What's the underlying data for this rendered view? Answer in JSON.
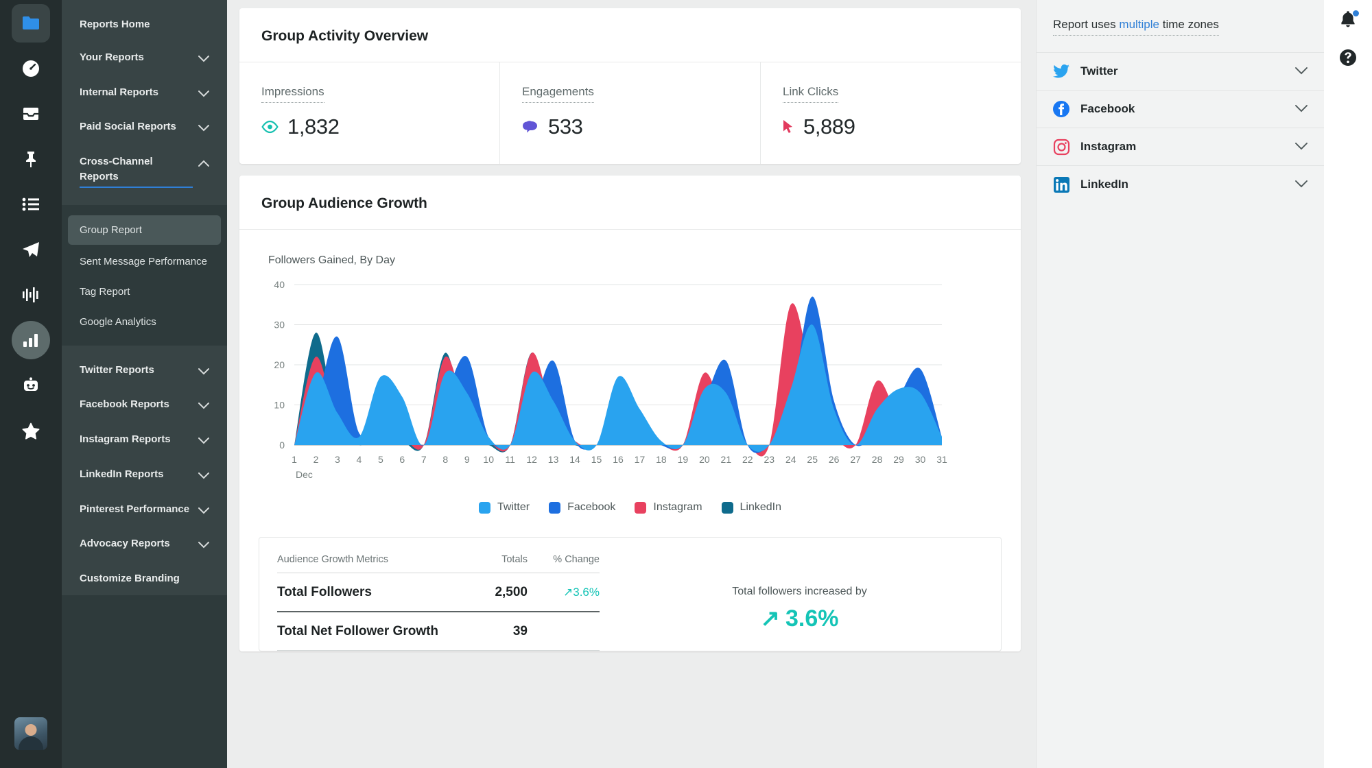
{
  "rail": {
    "items": [
      {
        "name": "folder-icon",
        "label": "Folder"
      },
      {
        "name": "dashboard-icon",
        "label": "Dashboard"
      },
      {
        "name": "inbox-icon",
        "label": "Inbox"
      },
      {
        "name": "pin-icon",
        "label": "Publishing"
      },
      {
        "name": "list-icon",
        "label": "Tasks"
      },
      {
        "name": "send-icon",
        "label": "Compose"
      },
      {
        "name": "pulse-icon",
        "label": "Listening"
      },
      {
        "name": "bar-chart-icon",
        "label": "Analytics"
      },
      {
        "name": "bot-icon",
        "label": "Bots"
      },
      {
        "name": "star-icon",
        "label": "Favorites"
      }
    ]
  },
  "nav": {
    "primary": [
      {
        "label": "Reports Home",
        "chevron": false,
        "underlined": false
      },
      {
        "label": "Your Reports",
        "chevron": true,
        "underlined": false
      },
      {
        "label": "Internal Reports",
        "chevron": true,
        "underlined": false
      },
      {
        "label": "Paid Social Reports",
        "chevron": true,
        "underlined": false
      },
      {
        "label": "Cross-Channel Reports",
        "chevron": true,
        "underlined": true
      }
    ],
    "sub": [
      {
        "label": "Group Report",
        "selected": true
      },
      {
        "label": "Sent Message Performance",
        "selected": false
      },
      {
        "label": "Tag Report",
        "selected": false
      },
      {
        "label": "Google Analytics",
        "selected": false
      }
    ],
    "secondary": [
      {
        "label": "Twitter Reports",
        "chevron": true
      },
      {
        "label": "Facebook Reports",
        "chevron": true
      },
      {
        "label": "Instagram Reports",
        "chevron": true
      },
      {
        "label": "LinkedIn Reports",
        "chevron": true
      },
      {
        "label": "Pinterest Performance",
        "chevron": true
      },
      {
        "label": "Advocacy Reports",
        "chevron": true
      },
      {
        "label": "Customize Branding",
        "chevron": false
      }
    ]
  },
  "activity": {
    "title": "Group Activity Overview",
    "metrics": [
      {
        "label": "Impressions",
        "value": "1,832",
        "icon": "eye-icon",
        "color": "#16c0b0"
      },
      {
        "label": "Engagements",
        "value": "533",
        "icon": "speech-bubbles-icon",
        "color": "#6155d6"
      },
      {
        "label": "Link Clicks",
        "value": "5,889",
        "icon": "cursor-arrow-icon",
        "color": "#e23a5e"
      }
    ]
  },
  "growth": {
    "title": "Group Audience Growth",
    "subtitle": "Followers Gained, By Day",
    "table": {
      "headers": [
        "Audience Growth Metrics",
        "Totals",
        "% Change"
      ],
      "rows": [
        {
          "metric": "Total Followers",
          "total": "2,500",
          "change": "3.6%",
          "trend": "up"
        },
        {
          "metric": "Total Net Follower Growth",
          "total": "39",
          "change": "",
          "trend": ""
        }
      ]
    },
    "note": {
      "text": "Total followers increased by",
      "value": "3.6%"
    }
  },
  "chart_data": {
    "type": "area",
    "title": "Group Audience Growth",
    "subtitle": "Followers Gained, By Day",
    "xlabel": "Dec",
    "ylabel": "",
    "ylim": [
      0,
      40
    ],
    "yticks": [
      0,
      10,
      20,
      30,
      40
    ],
    "grid": true,
    "legend_position": "bottom",
    "x": [
      1,
      2,
      3,
      4,
      5,
      6,
      7,
      8,
      9,
      10,
      11,
      12,
      13,
      14,
      15,
      16,
      17,
      18,
      19,
      20,
      21,
      22,
      23,
      24,
      25,
      26,
      27,
      28,
      29,
      30,
      31
    ],
    "xtick_labels": [
      "1",
      "2",
      "3",
      "4",
      "5",
      "6",
      "7",
      "8",
      "9",
      "10",
      "11",
      "12",
      "13",
      "14",
      "15",
      "16",
      "17",
      "18",
      "19",
      "20",
      "21",
      "22",
      "23",
      "24",
      "25",
      "26",
      "27",
      "28",
      "29",
      "30",
      "31"
    ],
    "series": [
      {
        "name": "Twitter",
        "color": "#29a3ef",
        "values": [
          0,
          18,
          8,
          2,
          17,
          12,
          0,
          18,
          13,
          2,
          0,
          18,
          11,
          1,
          0,
          17,
          9,
          1,
          0,
          14,
          13,
          0,
          0,
          14,
          30,
          9,
          0,
          9,
          14,
          13,
          2
        ]
      },
      {
        "name": "Facebook",
        "color": "#1d6fe0",
        "values": [
          0,
          10,
          27,
          3,
          8,
          6,
          0,
          12,
          22,
          2,
          0,
          8,
          21,
          1,
          0,
          6,
          5,
          0,
          0,
          11,
          21,
          0,
          0,
          10,
          37,
          11,
          0,
          4,
          12,
          19,
          2
        ]
      },
      {
        "name": "Instagram",
        "color": "#e8415f",
        "values": [
          0,
          22,
          5,
          1,
          3,
          2,
          0,
          22,
          7,
          1,
          0,
          23,
          7,
          1,
          0,
          12,
          2,
          0,
          0,
          18,
          6,
          0,
          0,
          35,
          17,
          3,
          0,
          16,
          7,
          5,
          1
        ]
      },
      {
        "name": "LinkedIn",
        "color": "#0f6b8c",
        "values": [
          0,
          28,
          4,
          0,
          2,
          1,
          0,
          23,
          3,
          0,
          0,
          23,
          4,
          0,
          0,
          4,
          1,
          0,
          0,
          17,
          4,
          0,
          0,
          13,
          32,
          5,
          0,
          5,
          4,
          18,
          1
        ]
      }
    ]
  },
  "rightpanel": {
    "timezone": {
      "prefix": "Report uses",
      "link": "multiple",
      "suffix": "time zones"
    },
    "networks": [
      {
        "label": "Twitter",
        "icon": "twitter-icon"
      },
      {
        "label": "Facebook",
        "icon": "facebook-icon"
      },
      {
        "label": "Instagram",
        "icon": "instagram-icon"
      },
      {
        "label": "LinkedIn",
        "icon": "linkedin-icon"
      }
    ]
  },
  "utilbar": {
    "items": [
      {
        "name": "notification-bell-icon",
        "label": "Notifications",
        "badge": true
      },
      {
        "name": "help-icon",
        "label": "Help",
        "badge": false
      }
    ]
  }
}
